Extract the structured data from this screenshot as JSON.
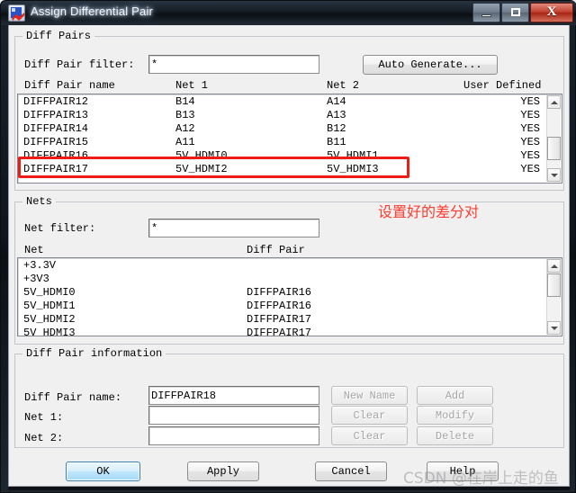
{
  "window": {
    "title": "Assign Differential Pair",
    "icon": "diffpair-app-icon",
    "buttons": {
      "minimize": "minimize-icon",
      "maximize": "maximize-icon",
      "close": "X"
    }
  },
  "diff_pairs": {
    "legend": "Diff Pairs",
    "filter_label": "Diff Pair filter:",
    "filter_value": "*",
    "auto_generate_label": "Auto Generate...",
    "columns": [
      "Diff Pair name",
      "Net 1",
      "Net 2",
      "User Defined"
    ],
    "rows": [
      {
        "name": "DIFFPAIR12",
        "net1": "B14",
        "net2": "A14",
        "user_defined": "YES"
      },
      {
        "name": "DIFFPAIR13",
        "net1": "B13",
        "net2": "A13",
        "user_defined": "YES"
      },
      {
        "name": "DIFFPAIR14",
        "net1": "A12",
        "net2": "B12",
        "user_defined": "YES"
      },
      {
        "name": "DIFFPAIR15",
        "net1": "A11",
        "net2": "B11",
        "user_defined": "YES"
      },
      {
        "name": "DIFFPAIR16",
        "net1": "5V_HDMI0",
        "net2": "5V_HDMI1",
        "user_defined": "YES"
      },
      {
        "name": "DIFFPAIR17",
        "net1": "5V_HDMI2",
        "net2": "5V_HDMI3",
        "user_defined": "YES"
      }
    ]
  },
  "nets": {
    "legend": "Nets",
    "filter_label": "Net filter:",
    "filter_value": "*",
    "columns": [
      "Net",
      "Diff Pair"
    ],
    "rows": [
      {
        "net": "+3.3V",
        "diff_pair": ""
      },
      {
        "net": "+3V3",
        "diff_pair": ""
      },
      {
        "net": "5V_HDMI0",
        "diff_pair": "DIFFPAIR16"
      },
      {
        "net": "5V_HDMI1",
        "diff_pair": "DIFFPAIR16"
      },
      {
        "net": "5V_HDMI2",
        "diff_pair": "DIFFPAIR17"
      },
      {
        "net": "5V_HDMI3",
        "diff_pair": "DIFFPAIR17"
      }
    ]
  },
  "diff_pair_information": {
    "legend": "Diff Pair information",
    "name_label": "Diff Pair name:",
    "name_value": "DIFFPAIR18",
    "net1_label": "Net 1:",
    "net1_value": "",
    "net2_label": "Net 2:",
    "net2_value": "",
    "buttons": {
      "new_name": "New Name",
      "add": "Add",
      "clear_net1": "Clear",
      "modify": "Modify",
      "clear_net2": "Clear",
      "delete": "Delete"
    }
  },
  "footer": {
    "ok": "OK",
    "apply": "Apply",
    "cancel": "Cancel",
    "help": "Help"
  },
  "annotation": {
    "text": "设置好的差分对",
    "color": "#ff3b2e",
    "highlight_color": "#ee1c16"
  },
  "watermark": {
    "text": "CSDN @在岸上走的鱼"
  }
}
